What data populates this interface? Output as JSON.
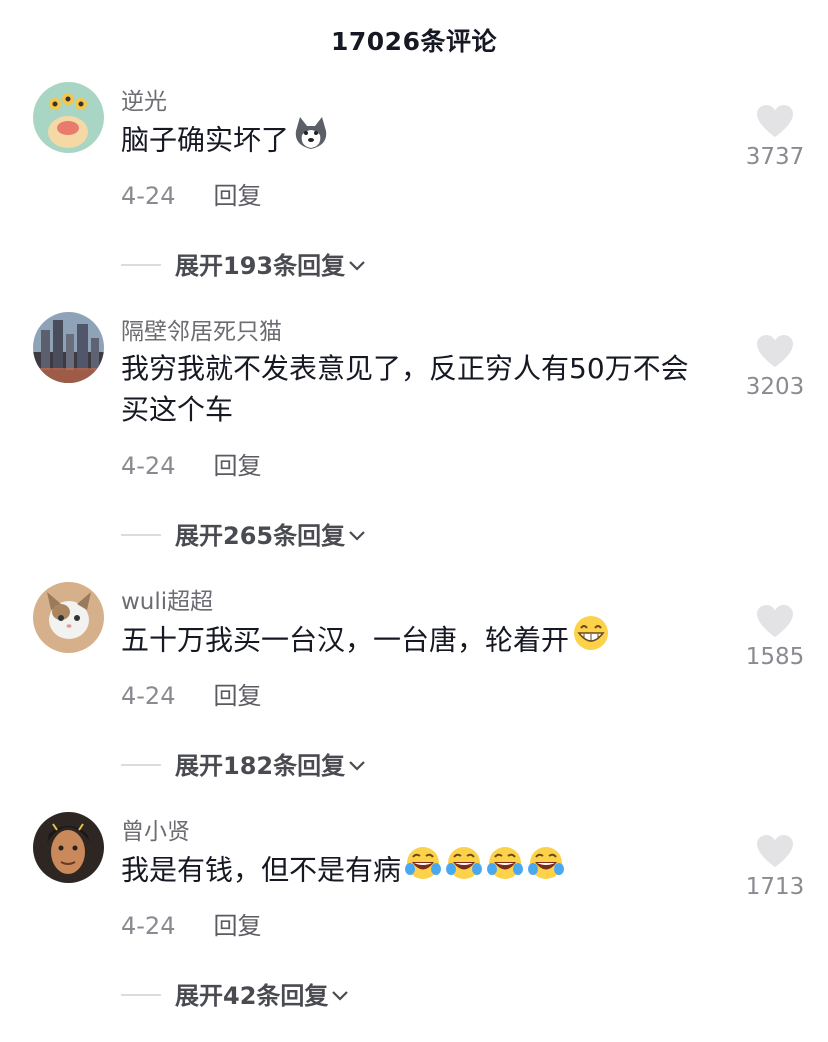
{
  "header": {
    "title": "17026条评论"
  },
  "comments": [
    {
      "username": "逆光",
      "text": "脑子确实坏了",
      "emoji": [
        "husky-dog-emoji"
      ],
      "date": "4-24",
      "reply_label": "回复",
      "likes": "3737",
      "expand_label": "展开193条回复"
    },
    {
      "username": "隔壁邻居死只猫",
      "text": "我穷我就不发表意见了，反正穷人有50万不会买这个车",
      "emoji": [],
      "date": "4-24",
      "reply_label": "回复",
      "likes": "3203",
      "expand_label": "展开265条回复"
    },
    {
      "username": "wuli超超",
      "text": "五十万我买一台汉，一台唐，轮着开",
      "emoji": [
        "grin-emoji"
      ],
      "date": "4-24",
      "reply_label": "回复",
      "likes": "1585",
      "expand_label": "展开182条回复"
    },
    {
      "username": "曾小贤",
      "text": "我是有钱，但不是有病",
      "emoji": [
        "rofl-emoji",
        "rofl-emoji",
        "rofl-emoji",
        "rofl-emoji"
      ],
      "date": "4-24",
      "reply_label": "回复",
      "likes": "1713",
      "expand_label": "展开42条回复"
    }
  ],
  "colors": {
    "primary_text": "#161823",
    "secondary_text": "#8a8b91",
    "heart": "#e3e3e5"
  }
}
